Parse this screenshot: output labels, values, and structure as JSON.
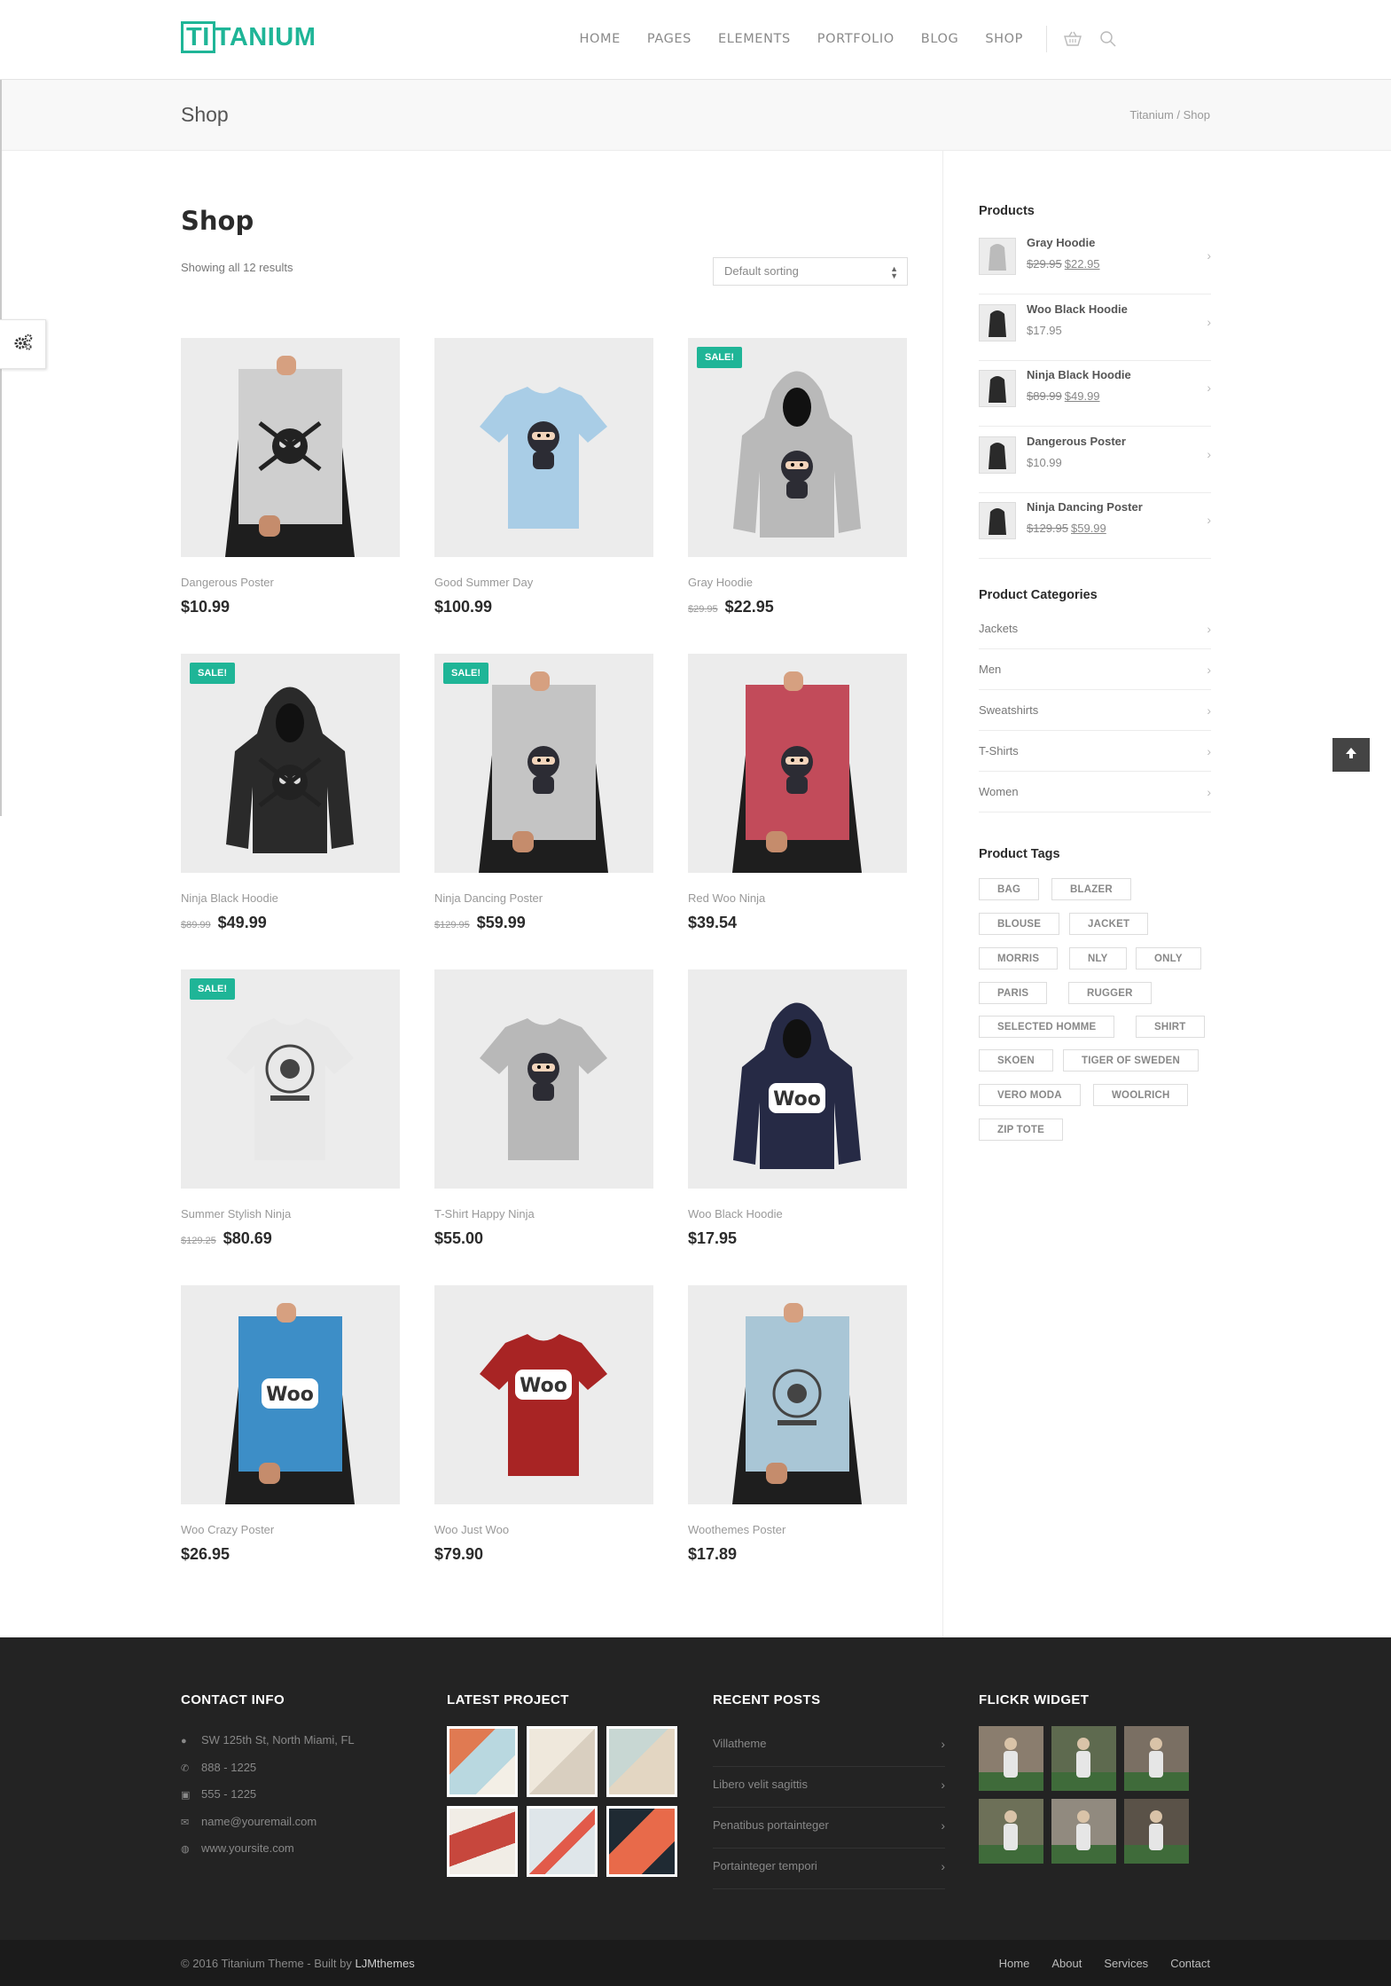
{
  "header": {
    "logo_mark": "TI",
    "logo_rest": "TANIUM",
    "nav": [
      "HOME",
      "PAGES",
      "ELEMENTS",
      "PORTFOLIO",
      "BLOG",
      "SHOP"
    ],
    "cart_icon": "basket-icon",
    "search_icon": "search-icon"
  },
  "titlebar": {
    "title": "Shop",
    "breadcrumb_home": "Titanium",
    "breadcrumb_sep": " / ",
    "breadcrumb_current": "Shop"
  },
  "main": {
    "heading": "Shop",
    "showing": "Showing all 12 results",
    "sorting": "Default sorting",
    "sale_label": "SALE!",
    "products": [
      {
        "name": "Dangerous Poster",
        "old": "",
        "price": "$10.99",
        "sale": false,
        "kind": "poster-skull"
      },
      {
        "name": "Good Summer Day",
        "old": "",
        "price": "$100.99",
        "sale": false,
        "kind": "tee-blue"
      },
      {
        "name": "Gray Hoodie",
        "old": "$29.95",
        "price": "$22.95",
        "sale": true,
        "kind": "hoodie-gray"
      },
      {
        "name": "Ninja Black Hoodie",
        "old": "$89.99",
        "price": "$49.99",
        "sale": true,
        "kind": "hoodie-black"
      },
      {
        "name": "Ninja Dancing Poster",
        "old": "$129.95",
        "price": "$59.99",
        "sale": true,
        "kind": "poster-ninja"
      },
      {
        "name": "Red Woo Ninja",
        "old": "",
        "price": "$39.54",
        "sale": false,
        "kind": "poster-red"
      },
      {
        "name": "Summer Stylish Ninja",
        "old": "$129.25",
        "price": "$80.69",
        "sale": true,
        "kind": "tee-white"
      },
      {
        "name": "T-Shirt Happy Ninja",
        "old": "",
        "price": "$55.00",
        "sale": false,
        "kind": "tee-gray"
      },
      {
        "name": "Woo Black Hoodie",
        "old": "",
        "price": "$17.95",
        "sale": false,
        "kind": "hoodie-navy"
      },
      {
        "name": "Woo Crazy Poster",
        "old": "",
        "price": "$26.95",
        "sale": false,
        "kind": "poster-blue"
      },
      {
        "name": "Woo Just Woo",
        "old": "",
        "price": "$79.90",
        "sale": false,
        "kind": "tee-red"
      },
      {
        "name": "Woothemes Poster",
        "old": "",
        "price": "$17.89",
        "sale": false,
        "kind": "poster-light"
      }
    ]
  },
  "sidebar": {
    "products_title": "Products",
    "products": [
      {
        "name": "Gray Hoodie",
        "old": "$29.95",
        "price": "$22.95"
      },
      {
        "name": "Woo Black Hoodie",
        "old": "",
        "price": "$17.95"
      },
      {
        "name": "Ninja Black Hoodie",
        "old": "$89.99",
        "price": "$49.99"
      },
      {
        "name": "Dangerous Poster",
        "old": "",
        "price": "$10.99"
      },
      {
        "name": "Ninja Dancing Poster",
        "old": "$129.95",
        "price": "$59.99"
      }
    ],
    "categories_title": "Product Categories",
    "categories": [
      "Jackets",
      "Men",
      "Sweatshirts",
      "T-Shirts",
      "Women"
    ],
    "tags_title": "Product Tags",
    "tags": [
      "BAG",
      "BLAZER",
      "BLOUSE",
      "JACKET",
      "MORRIS",
      "NLY",
      "ONLY",
      "PARIS",
      "RUGGER",
      "SELECTED HOMME",
      "SHIRT",
      "SKOEN",
      "TIGER OF SWEDEN",
      "VERO MODA",
      "WOOLRICH",
      "ZIP TOTE"
    ]
  },
  "footer": {
    "contact_title": "CONTACT INFO",
    "contact": [
      {
        "icon": "map-marker-icon",
        "text": "SW 125th St, North Miami, FL"
      },
      {
        "icon": "phone-icon",
        "text": "888 - 1225"
      },
      {
        "icon": "fax-icon",
        "text": "555 - 1225"
      },
      {
        "icon": "envelope-icon",
        "text": "name@youremail.com"
      },
      {
        "icon": "globe-icon",
        "text": "www.yoursite.com"
      }
    ],
    "project_title": "LATEST PROJECT",
    "posts_title": "RECENT POSTS",
    "posts": [
      "Villatheme",
      "Libero velit sagittis",
      "Penatibus portainteger",
      "Portainteger tempori"
    ],
    "flickr_title": "FLICKR WIDGET",
    "copyright_prefix": "© 2016 Titanium Theme - Built by ",
    "copyright_author": "LJMthemes",
    "links": [
      "Home",
      "About",
      "Services",
      "Contact"
    ]
  },
  "colors": {
    "accent": "#1fb597",
    "footer_bg": "#232323"
  }
}
